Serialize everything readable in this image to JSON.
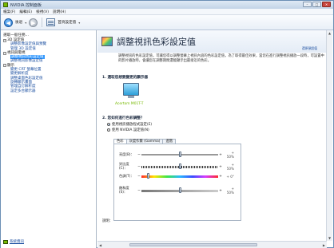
{
  "window": {
    "title": "NVIDIA 控制面板",
    "min_label": "–",
    "max_label": "□",
    "close_label": "✕"
  },
  "menu": [
    "檔案(F)",
    "編輯(E)",
    "檢視(V)",
    "說明(H)"
  ],
  "toolbar": {
    "back_label": "後退",
    "back_glyph": "◀",
    "forward_glyph": "▶",
    "home_label": "首頁設定值",
    "caret": "▾"
  },
  "sidebar": {
    "heading": "選取一般任務...",
    "items": [
      {
        "label": "3D 設定值",
        "level": 1,
        "expander": "−"
      },
      {
        "label": "調整影像設定值與預覽",
        "level": 2
      },
      {
        "label": "管理 3D 設定值",
        "level": 2
      },
      {
        "label": "視訊與電視",
        "level": 1,
        "expander": "−"
      },
      {
        "label": "調整視訊色彩設定值",
        "level": 2,
        "selected": true
      },
      {
        "label": "調整視訊影像設定值",
        "level": 2
      },
      {
        "label": "顯示",
        "level": 1,
        "expander": "−"
      },
      {
        "label": "變更 CRT 螢幕位置",
        "level": 2
      },
      {
        "label": "變更解析度",
        "level": 2
      },
      {
        "label": "調整桌面色彩設定值",
        "level": 2
      },
      {
        "label": "旋轉顯示畫面",
        "level": 2
      },
      {
        "label": "管理自訂解析度",
        "level": 2
      },
      {
        "label": "設定多台顯示器",
        "level": 2
      }
    ],
    "footer_link": "系統資訊"
  },
  "page": {
    "title": "調整視訊色彩設定值",
    "restore": "還原預設值",
    "description": "調整視訊的色彩設定值，可讓您得以調整螢幕上視訊內容的色彩設定值，為了取得最佳效果，當您在進行調整視訊播放一段時，可設置中的影片播放時，會讓您在調整期間還能顯示出最接近的色彩。",
    "section1": "1. 選取您想要變更的顯示器",
    "monitor_label": "Acertom M01T-T",
    "section2": "2. 您如何進行色彩調整？",
    "radio1": "使用視訊播放程式設定(E)",
    "radio2": "使用 NVIDIA 設定值(N)",
    "tabs": [
      "色彩",
      "灰度作繫 (Gamma)",
      "進階"
    ],
    "sliders": [
      {
        "label": "亮度(B)：",
        "value_text": "+ 50%",
        "fraction": 0.5,
        "style": "plain"
      },
      {
        "label": "對比度(C)：",
        "value_text": "+ 50%",
        "fraction": 0.5,
        "style": "dash"
      },
      {
        "label": "色調(T)：",
        "value_text": "+ 0°",
        "fraction": 0.08,
        "style": "color"
      },
      {
        "label": "飽和度(S)：",
        "value_text": "+ 50%",
        "fraction": 0.5,
        "style": "grey"
      }
    ],
    "note": "說明："
  }
}
